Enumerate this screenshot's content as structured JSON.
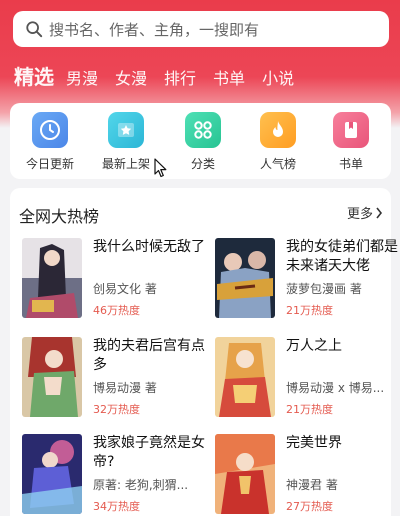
{
  "search": {
    "placeholder": "搜书名、作者、主角，一搜即有"
  },
  "tabs": [
    {
      "label": "精选",
      "active": true
    },
    {
      "label": "男漫"
    },
    {
      "label": "女漫"
    },
    {
      "label": "排行"
    },
    {
      "label": "书单"
    },
    {
      "label": "小说"
    }
  ],
  "shortcuts": [
    {
      "label": "今日更新",
      "icon": "clock-icon",
      "color": "#5b9bf0"
    },
    {
      "label": "最新上架",
      "icon": "star-icon",
      "color": "#3fc7e0"
    },
    {
      "label": "分类",
      "icon": "grid-icon",
      "color": "#3dd3a8"
    },
    {
      "label": "人气榜",
      "icon": "flame-icon",
      "color": "#ffb13a"
    },
    {
      "label": "书单",
      "icon": "book-icon",
      "color": "#f06a8a"
    }
  ],
  "ranking": {
    "title": "全网大热榜",
    "more_label": "更多",
    "books": [
      {
        "title": "我什么时候无敌了",
        "author": "创易文化 著",
        "heat": "46万热度"
      },
      {
        "title": "我的女徒弟们都是未来诸天大佬",
        "author": "菠萝包漫画 著",
        "heat": "21万热度"
      },
      {
        "title": "我的夫君后宫有点多",
        "author": "博易动漫 著",
        "heat": "32万热度"
      },
      {
        "title": "万人之上",
        "author": "博易动漫 x 博易...",
        "heat": "21万热度"
      },
      {
        "title": "我家娘子竟然是女帝?",
        "author": "原著: 老狗,刺猬...",
        "heat": "34万热度"
      },
      {
        "title": "完美世界",
        "author": "神漫君 著",
        "heat": "27万热度"
      }
    ]
  },
  "colors": {
    "brand": "#ea3c4b",
    "heat": "#e45a4f"
  }
}
